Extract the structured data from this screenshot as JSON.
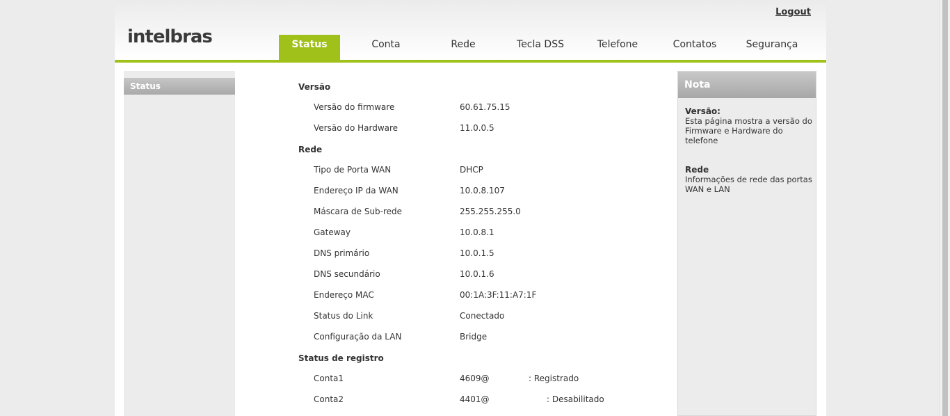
{
  "header": {
    "logo_text": "intelbras",
    "logout_label": "Logout"
  },
  "nav": {
    "tabs": [
      {
        "label": "Status",
        "active": true
      },
      {
        "label": "Conta"
      },
      {
        "label": "Rede"
      },
      {
        "label": "Tecla DSS"
      },
      {
        "label": "Telefone"
      },
      {
        "label": "Contatos"
      },
      {
        "label": "Segurança"
      }
    ]
  },
  "sidebar": {
    "items": [
      {
        "label": "Status"
      }
    ]
  },
  "main": {
    "versao": {
      "title": "Versão",
      "rows": [
        {
          "label": "Versão do firmware",
          "value": "60.61.75.15"
        },
        {
          "label": "Versão do Hardware",
          "value": "11.0.0.5"
        }
      ]
    },
    "rede": {
      "title": "Rede",
      "rows": [
        {
          "label": "Tipo de Porta WAN",
          "value": "DHCP"
        },
        {
          "label": "Endereço IP da WAN",
          "value": "10.0.8.107"
        },
        {
          "label": "Máscara de Sub-rede",
          "value": "255.255.255.0"
        },
        {
          "label": "Gateway",
          "value": "10.0.8.1"
        },
        {
          "label": "DNS primário",
          "value": "10.0.1.5"
        },
        {
          "label": "DNS secundário",
          "value": "10.0.1.6"
        },
        {
          "label": "Endereço MAC",
          "value": "00:1A:3F:11:A7:1F"
        },
        {
          "label": "Status do Link",
          "value": "Conectado"
        },
        {
          "label": "Configuração da LAN",
          "value": "Bridge"
        }
      ]
    },
    "registro": {
      "title": "Status de registro",
      "rows": [
        {
          "label": "Conta1",
          "value": "4609@",
          "status": ": Registrado"
        },
        {
          "label": "Conta2",
          "value": "4401@",
          "status": ": Desabilitado"
        }
      ]
    }
  },
  "nota": {
    "title": "Nota",
    "versao_title": "Versão:",
    "versao_text": "Esta página mostra a versão do Firmware e Hardware do telefone",
    "rede_title": "Rede",
    "rede_text": "Informações de rede das portas WAN e LAN"
  }
}
